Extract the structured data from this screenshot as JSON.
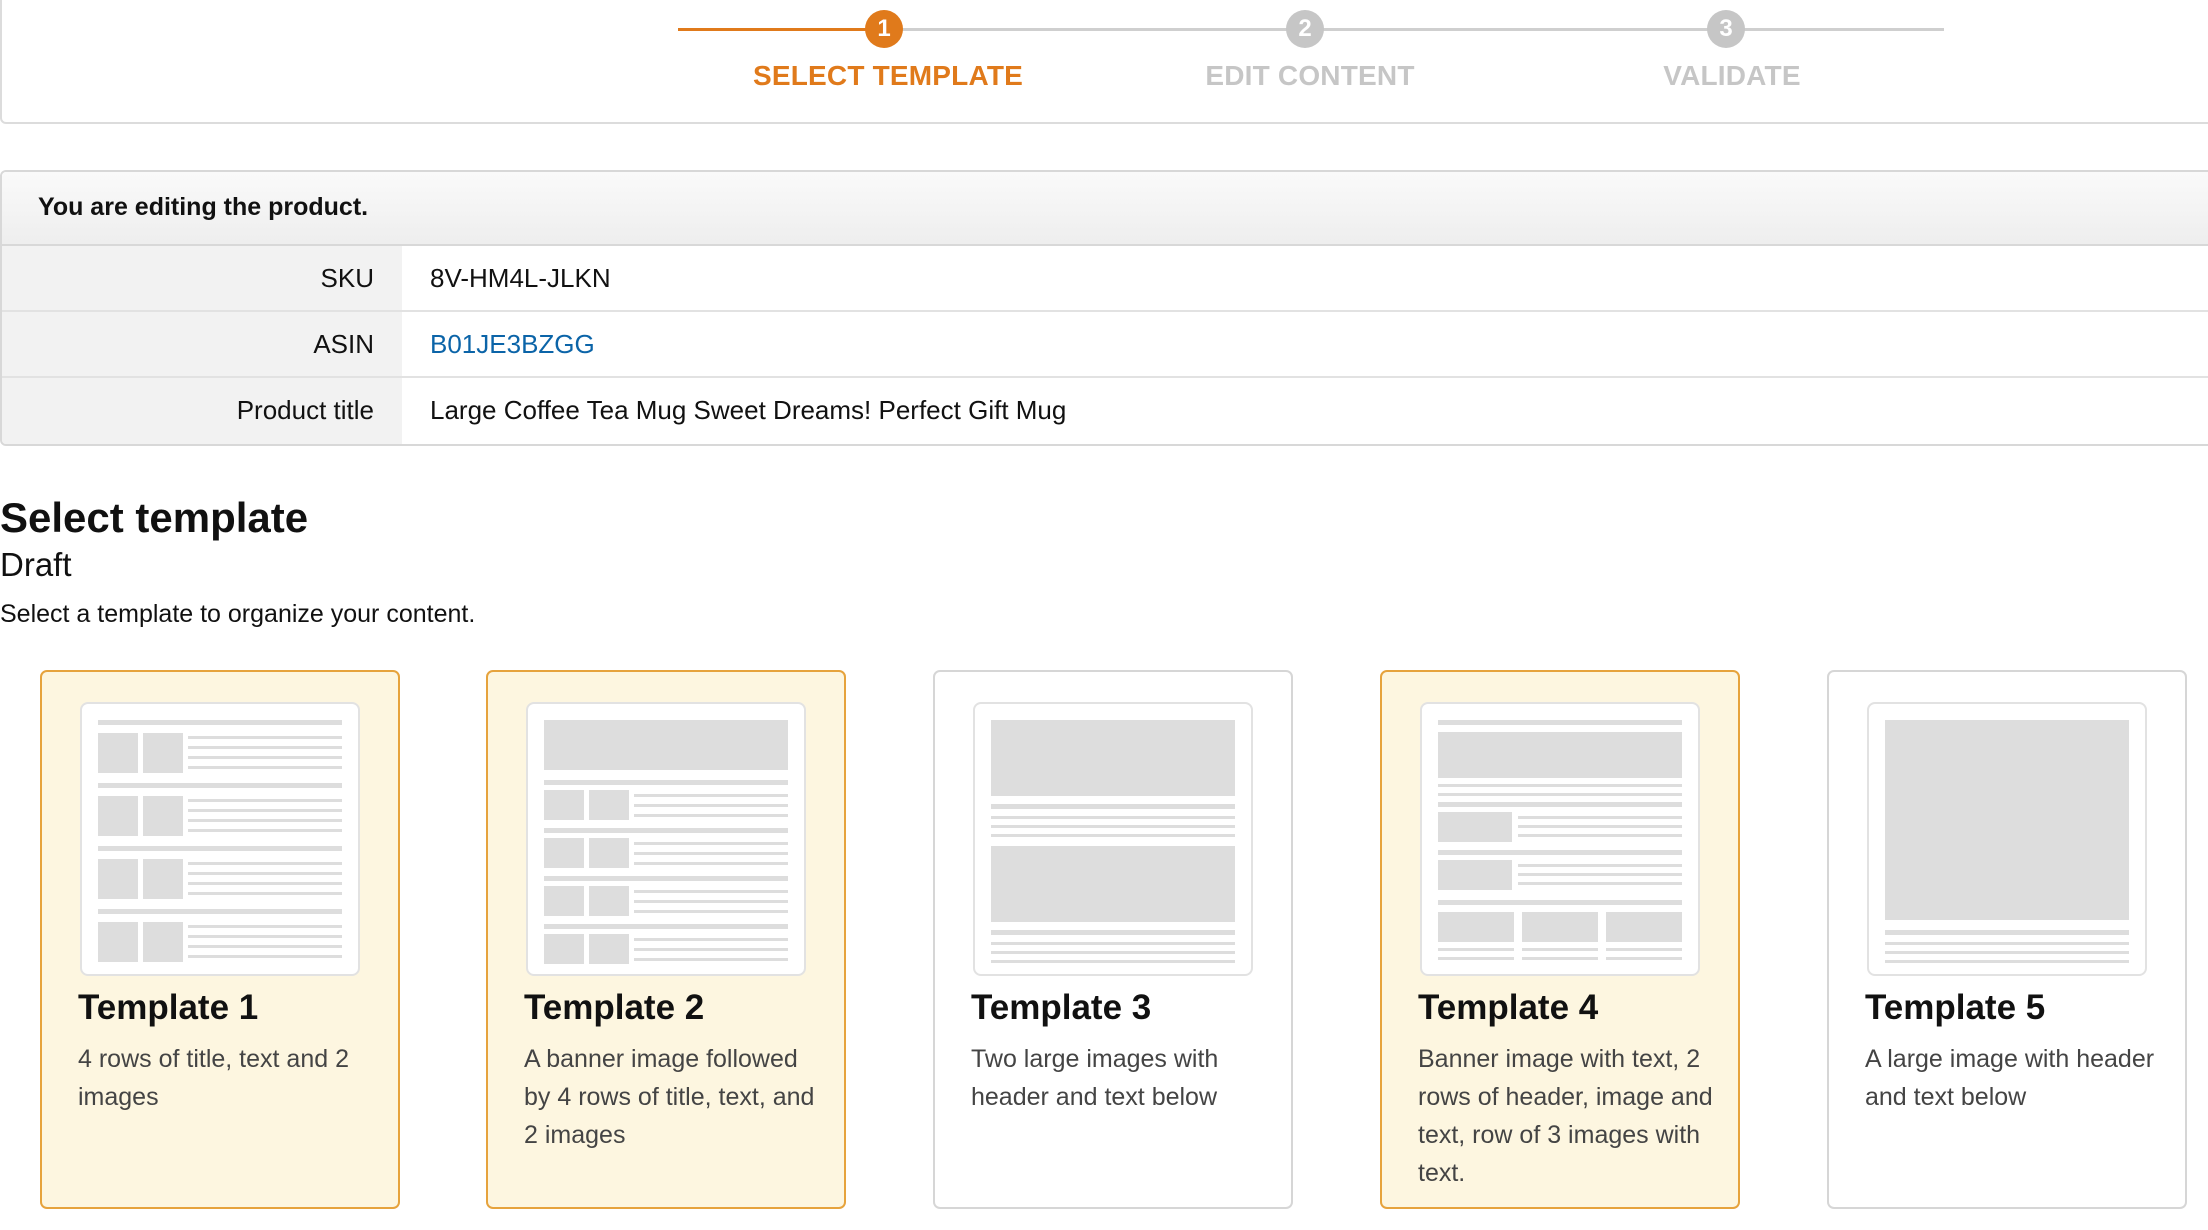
{
  "stepper": {
    "steps": [
      {
        "number": "1",
        "label": "SELECT TEMPLATE"
      },
      {
        "number": "2",
        "label": "EDIT CONTENT"
      },
      {
        "number": "3",
        "label": "VALIDATE"
      }
    ],
    "active_step": 1,
    "colors": {
      "active": "#e07a1b",
      "inactive": "#c6c6c6"
    }
  },
  "product": {
    "header": "You are editing the product.",
    "rows": [
      {
        "key": "SKU",
        "value": "8V-HM4L-JLKN"
      },
      {
        "key": "ASIN",
        "value": "B01JE3BZGG"
      },
      {
        "key": "Product title",
        "value": "Large Coffee Tea Mug Sweet Dreams! Perfect Gift Mug"
      }
    ]
  },
  "section": {
    "title": "Select template",
    "status": "Draft",
    "description": "Select a template to organize your content."
  },
  "templates": [
    {
      "title": "Template 1",
      "description": "4 rows of title, text and 2 images",
      "selected": true
    },
    {
      "title": "Template 2",
      "description": "A banner image followed by 4 rows of title, text, and 2 images",
      "selected": true
    },
    {
      "title": "Template 3",
      "description": "Two large images with header and text below",
      "selected": false
    },
    {
      "title": "Template 4",
      "description": "Banner image with text, 2 rows of header, image and text, row of 3 images with text.",
      "selected": true
    },
    {
      "title": "Template 5",
      "description": "A large image with header and text below",
      "selected": false
    }
  ],
  "colors": {
    "link": "#0b64a8",
    "selected_bg": "#fdf6e0",
    "selected_border": "#e6a33d"
  }
}
